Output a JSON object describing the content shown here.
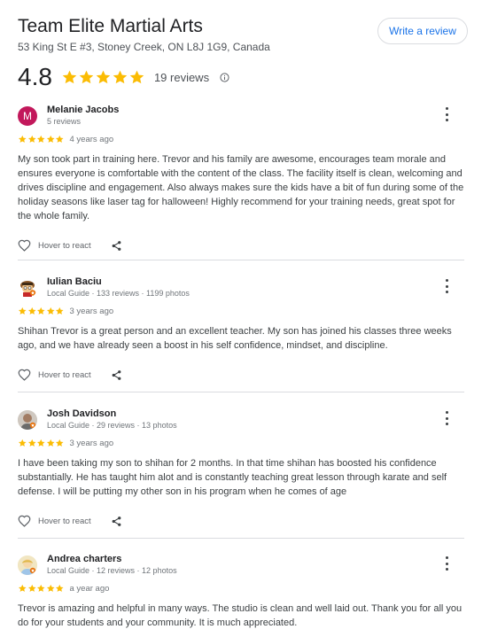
{
  "business": {
    "name": "Team Elite Martial Arts",
    "address": "53 King St E #3, Stoney Creek, ON L8J 1G9, Canada",
    "write_review_label": "Write a review",
    "rating": "4.8",
    "rating_stars": 5,
    "review_count": "19 reviews"
  },
  "colors": {
    "star": "#fbbc04",
    "link": "#1a73e8",
    "avatar_m": "#c2185b"
  },
  "actions": {
    "react_label": "Hover to react"
  },
  "reviews": [
    {
      "author": "Melanie Jacobs",
      "avatar_letter": "M",
      "meta": "5 reviews",
      "stars": 5,
      "time": "4 years ago",
      "text": "My son took part in training here. Trevor and his family are awesome, encourages team morale and ensures everyone is comfortable with the content of the class. The facility itself is clean, welcoming and drives discipline and engagement. Also always makes sure the kids have a bit of fun during some of the holiday seasons like laser tag for halloween! Highly recommend for your training needs, great spot for the whole family."
    },
    {
      "author": "Iulian Baciu",
      "avatar_icon": "cartoon-avatar-icon",
      "meta": "Local Guide · 133 reviews · 1199 photos",
      "stars": 5,
      "time": "3 years ago",
      "text": "Shihan Trevor is a great person and an excellent teacher. My son has joined his classes three weeks ago, and we have already seen a boost in his self confidence, mindset, and discipline."
    },
    {
      "author": "Josh Davidson",
      "avatar_icon": "profile-photo-icon",
      "meta": "Local Guide · 29 reviews · 13 photos",
      "stars": 5,
      "time": "3 years ago",
      "text": "I have been taking my son to shihan for 2 months. In that time shihan has boosted his confidence substantially. He has taught him alot and is constantly teaching great lesson through karate and self defense. I will be putting my other son in his program when he comes of age"
    },
    {
      "author": "Andrea charters",
      "avatar_icon": "profile-photo-icon",
      "meta": "Local Guide · 12 reviews · 12 photos",
      "stars": 5,
      "time": "a year ago",
      "text": "Trevor is amazing and helpful in many ways. The studio is clean and well laid out. Thank you for all you do for your students and your community. It is much appreciated."
    }
  ]
}
